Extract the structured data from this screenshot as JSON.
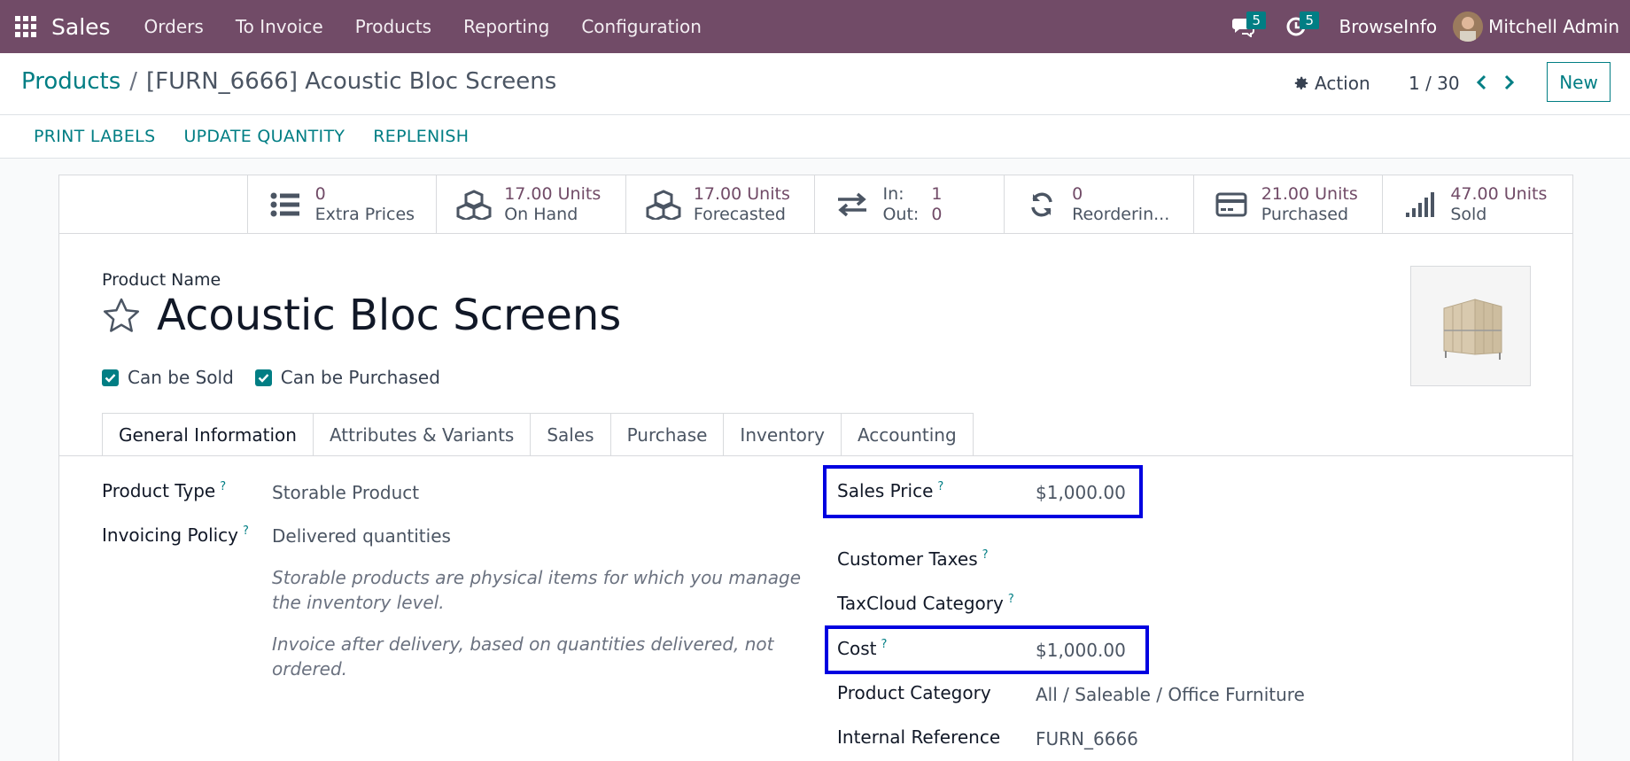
{
  "navbar": {
    "app_name": "Sales",
    "menu": [
      "Orders",
      "To Invoice",
      "Products",
      "Reporting",
      "Configuration"
    ],
    "messages_count": "5",
    "activities_count": "5",
    "company": "BrowseInfo",
    "user": "Mitchell Admin",
    "bg_color": "#714b67"
  },
  "control": {
    "breadcrumb_root": "Products",
    "breadcrumb_sep": "/",
    "breadcrumb_current": "[FURN_6666] Acoustic Bloc Screens",
    "action_label": "Action",
    "pager": "1 / 30",
    "new_label": "New"
  },
  "header_buttons": [
    "PRINT LABELS",
    "UPDATE QUANTITY",
    "REPLENISH"
  ],
  "stats": [
    {
      "icon": "list-icon",
      "value": "0",
      "label": "Extra Prices"
    },
    {
      "icon": "cubes-icon",
      "value": "17.00 Units",
      "label": "On Hand"
    },
    {
      "icon": "cubes-icon",
      "value": "17.00 Units",
      "label": "Forecasted"
    },
    {
      "icon": "exchange-icon",
      "in_label": "In:",
      "in_value": "1",
      "out_label": "Out:",
      "out_value": "0"
    },
    {
      "icon": "refresh-icon",
      "value": "0",
      "label": "Reorderin..."
    },
    {
      "icon": "credit-card-icon",
      "value": "21.00 Units",
      "label": "Purchased"
    },
    {
      "icon": "signal-icon",
      "value": "47.00 Units",
      "label": "Sold"
    }
  ],
  "product": {
    "name_label": "Product Name",
    "name": "Acoustic Bloc Screens",
    "can_be_sold": "Can be Sold",
    "can_be_purchased": "Can be Purchased"
  },
  "tabs": [
    "General Information",
    "Attributes & Variants",
    "Sales",
    "Purchase",
    "Inventory",
    "Accounting"
  ],
  "general": {
    "product_type_label": "Product Type",
    "product_type": "Storable Product",
    "invoicing_policy_label": "Invoicing Policy",
    "invoicing_policy": "Delivered quantities",
    "note_storable": "Storable products are physical items for which you manage the inventory level.",
    "note_invoice": "Invoice after delivery, based on quantities delivered, not ordered.",
    "sales_price_label": "Sales Price",
    "sales_price": "$1,000.00",
    "customer_taxes_label": "Customer Taxes",
    "taxcloud_label": "TaxCloud Category",
    "cost_label": "Cost",
    "cost": "$1,000.00",
    "category_label": "Product Category",
    "category": "All / Saleable / Office Furniture",
    "internal_ref_label": "Internal Reference",
    "internal_ref": "FURN_6666",
    "help_mark": "?"
  },
  "accent": "#017e84",
  "highlight": "#0000e0"
}
